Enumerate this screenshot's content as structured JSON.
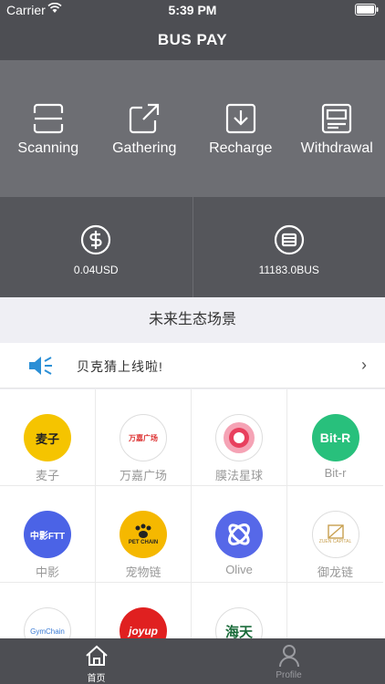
{
  "status": {
    "carrier": "Carrier",
    "time": "5:39 PM"
  },
  "nav": {
    "title": "BUS PAY"
  },
  "actions": [
    {
      "label": "Scanning",
      "icon": "scan-icon"
    },
    {
      "label": "Gathering",
      "icon": "share-out-icon"
    },
    {
      "label": "Recharge",
      "icon": "download-icon"
    },
    {
      "label": "Withdrawal",
      "icon": "card-icon"
    }
  ],
  "balances": [
    {
      "value": "0.04USD",
      "icon": "dollar-coin-icon"
    },
    {
      "value": "11183.0BUS",
      "icon": "bus-coin-icon"
    }
  ],
  "section": {
    "title": "未来生态场景"
  },
  "notice": {
    "text": "贝克猜上线啦!",
    "chevron": "›"
  },
  "apps": [
    {
      "name": "麦子",
      "logo_text": "麦子",
      "color": "#f5c400"
    },
    {
      "name": "万嘉广场",
      "logo_text": "万嘉广场",
      "color": "#ffffff"
    },
    {
      "name": "膜法星球",
      "logo_text": "",
      "color": "#ffffff"
    },
    {
      "name": "Bit-r",
      "logo_text": "Bit-R",
      "color": "#28c07c"
    },
    {
      "name": "中影",
      "logo_text": "中影FTT",
      "color": "#4b63e6"
    },
    {
      "name": "宠物链",
      "logo_text": "PET CHAIN",
      "color": "#f5b800"
    },
    {
      "name": "Olive",
      "logo_text": "",
      "color": "#5668e8"
    },
    {
      "name": "御龙链",
      "logo_text": "ZUEN CAPITAL",
      "color": "#ffffff"
    },
    {
      "name": "",
      "logo_text": "GymChain",
      "color": "#ffffff"
    },
    {
      "name": "",
      "logo_text": "joyup",
      "color": "#e02020"
    },
    {
      "name": "",
      "logo_text": "海天",
      "color": "#ffffff"
    }
  ],
  "tabs": [
    {
      "label": "首页",
      "icon": "home-icon",
      "active": true
    },
    {
      "label": "Profile",
      "icon": "person-icon",
      "active": false
    }
  ]
}
